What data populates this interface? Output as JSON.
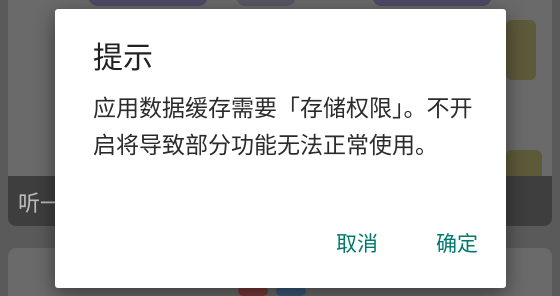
{
  "background": {
    "partial_text": "听一"
  },
  "dialog": {
    "title": "提示",
    "message": "应用数据缓存需要「存储权限」。不开启将导致部分功能无法正常使用。",
    "cancel_label": "取消",
    "confirm_label": "确定"
  },
  "colors": {
    "accent": "#00796b",
    "scrim": "#5a5a5a",
    "dialog_bg": "#ffffff"
  }
}
